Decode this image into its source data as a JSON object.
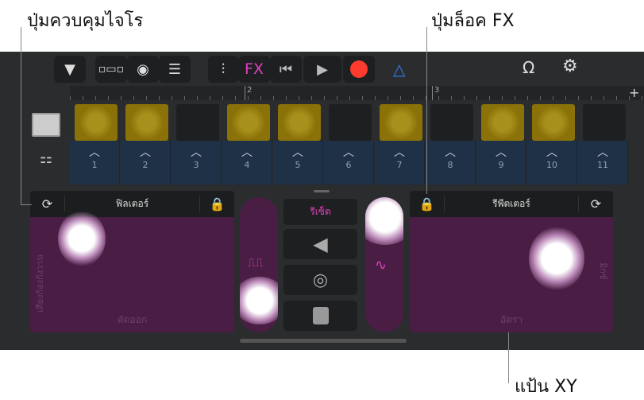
{
  "callouts": {
    "trackpad_control": "ปุ่มควบคุมไจโร",
    "fx_lock": "ปุ่มล็อค FX",
    "xy_pad": "แป้น XY"
  },
  "toolbar": {
    "fx_label": "FX",
    "accent": "#e040c0",
    "record_color": "#ff3b30",
    "metronome_color": "#2f7bf5"
  },
  "ruler": {
    "markers": [
      "2",
      "3"
    ]
  },
  "cells": {
    "row1": [
      "filled",
      "filled",
      "empty",
      "filled",
      "filled",
      "empty",
      "filled",
      "empty",
      "filled",
      "filled",
      "empty"
    ],
    "numbers": [
      "1",
      "2",
      "3",
      "4",
      "5",
      "6",
      "7",
      "8",
      "9",
      "10",
      "11"
    ]
  },
  "left_pad": {
    "title": "ฟิลเตอร์",
    "x_label": "ตัดออก",
    "y_label": "เสียงก้องกังวาน"
  },
  "right_pad": {
    "title": "รีพีตเตอร์",
    "x_label": "อัตรา",
    "y_label": "มิกซ์"
  },
  "center": {
    "reset_label": "รีเซ็ต"
  }
}
